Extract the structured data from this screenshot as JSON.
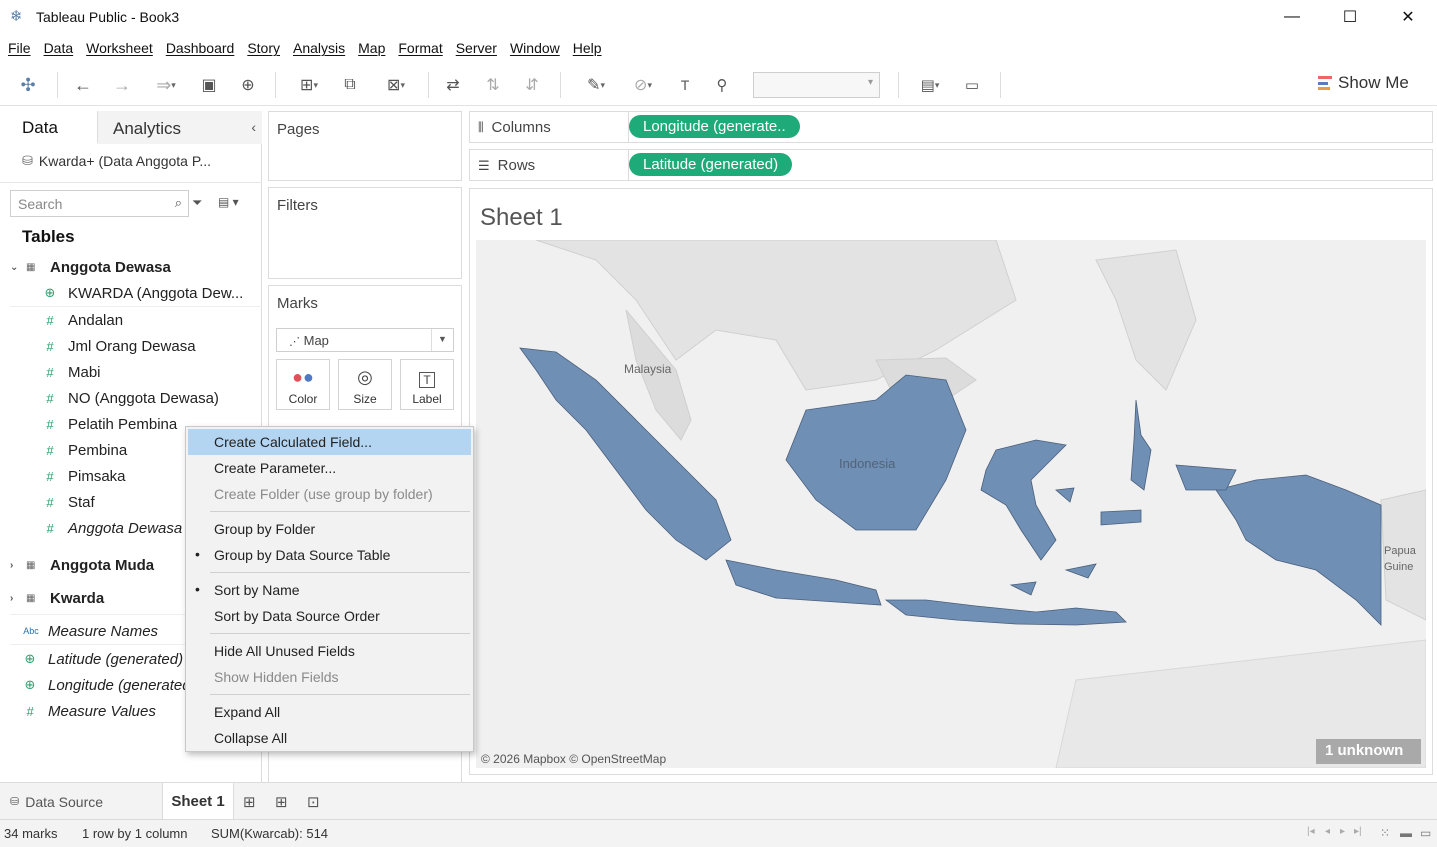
{
  "window": {
    "title": "Tableau Public - Book3",
    "minimize": "—",
    "maximize": "☐",
    "close": "✕"
  },
  "menu": [
    "File",
    "Data",
    "Worksheet",
    "Dashboard",
    "Story",
    "Analysis",
    "Map",
    "Format",
    "Server",
    "Window",
    "Help"
  ],
  "toolbar": {
    "show_me": "Show Me"
  },
  "left_panel": {
    "tab_data": "Data",
    "tab_analytics": "Analytics",
    "datasource": "Kwarda+ (Data Anggota P...",
    "search_placeholder": "Search",
    "tables_heading": "Tables",
    "tables": [
      {
        "name": "Anggota Dewasa"
      },
      {
        "name": "Anggota Muda"
      },
      {
        "name": "Kwarda"
      }
    ],
    "fields": [
      "KWARDA (Anggota Dew...",
      "Andalan",
      "Jml Orang Dewasa",
      "Mabi",
      "NO (Anggota Dewasa)",
      "Pelatih Pembina",
      "Pembina",
      "Pimsaka",
      "Staf",
      "Anggota Dewasa"
    ],
    "extra_fields": [
      "Measure Names",
      "Latitude (generated)",
      "Longitude (generated)",
      "Measure Values"
    ],
    "abc_icon": "Abc"
  },
  "shelves": {
    "pages": "Pages",
    "filters": "Filters",
    "marks": "Marks",
    "marks_type": "Map",
    "color": "Color",
    "size": "Size",
    "label": "Label",
    "columns": "Columns",
    "rows": "Rows",
    "columns_pill": "Longitude (generate..",
    "rows_pill": "Latitude (generated)"
  },
  "sheet": {
    "title": "Sheet 1",
    "map_labels": {
      "malaysia": "Malaysia",
      "indonesia": "Indonesia",
      "papua1": "Papua",
      "papua2": "Guine"
    },
    "attribution": "© 2026 Mapbox © OpenStreetMap",
    "unknown": "1 unknown"
  },
  "context_menu": [
    {
      "label": "Create Calculated Field...",
      "state": "highlighted"
    },
    {
      "label": "Create Parameter...",
      "state": "normal"
    },
    {
      "label": "Create Folder (use group by folder)",
      "state": "disabled"
    },
    {
      "label": "Group by Folder",
      "state": "normal"
    },
    {
      "label": "Group by Data Source Table",
      "state": "checked"
    },
    {
      "label": "Sort by Name",
      "state": "checked"
    },
    {
      "label": "Sort by Data Source Order",
      "state": "normal"
    },
    {
      "label": "Hide All Unused Fields",
      "state": "normal"
    },
    {
      "label": "Show Hidden Fields",
      "state": "disabled"
    },
    {
      "label": "Expand All",
      "state": "normal"
    },
    {
      "label": "Collapse All",
      "state": "normal"
    }
  ],
  "bottom": {
    "data_source_tab": "Data Source",
    "sheet_tab": "Sheet 1"
  },
  "status": {
    "marks": "34 marks",
    "rows_cols": "1 row by 1 column",
    "sum": "SUM(Kwarcab): 514"
  },
  "colors": {
    "pill_green": "#1fab79",
    "map_land": "#6f8fb5",
    "highlight": "#b3d5f2"
  }
}
